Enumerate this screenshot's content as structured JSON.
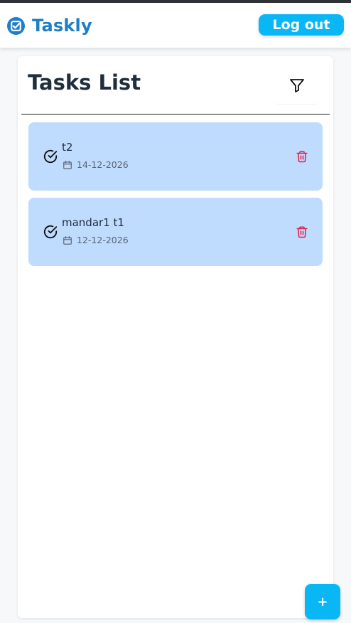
{
  "app": {
    "name": "Taskly",
    "brand_color": "#1e7ec8",
    "brand_icon": "checkbox-icon"
  },
  "header": {
    "logout_label": "Log out",
    "accent_color": "#08b7f4"
  },
  "main": {
    "title": "Tasks List",
    "filter_icon": "filter-icon",
    "tasks": [
      {
        "title": "t2",
        "date": "14-12-2026",
        "completed": true
      },
      {
        "title": "mandar1 t1",
        "date": "12-12-2026",
        "completed": true
      }
    ],
    "task_bg_color": "#bfdbfe",
    "delete_color": "#e11d48"
  },
  "fab": {
    "label": "+",
    "icon": "plus-icon"
  }
}
